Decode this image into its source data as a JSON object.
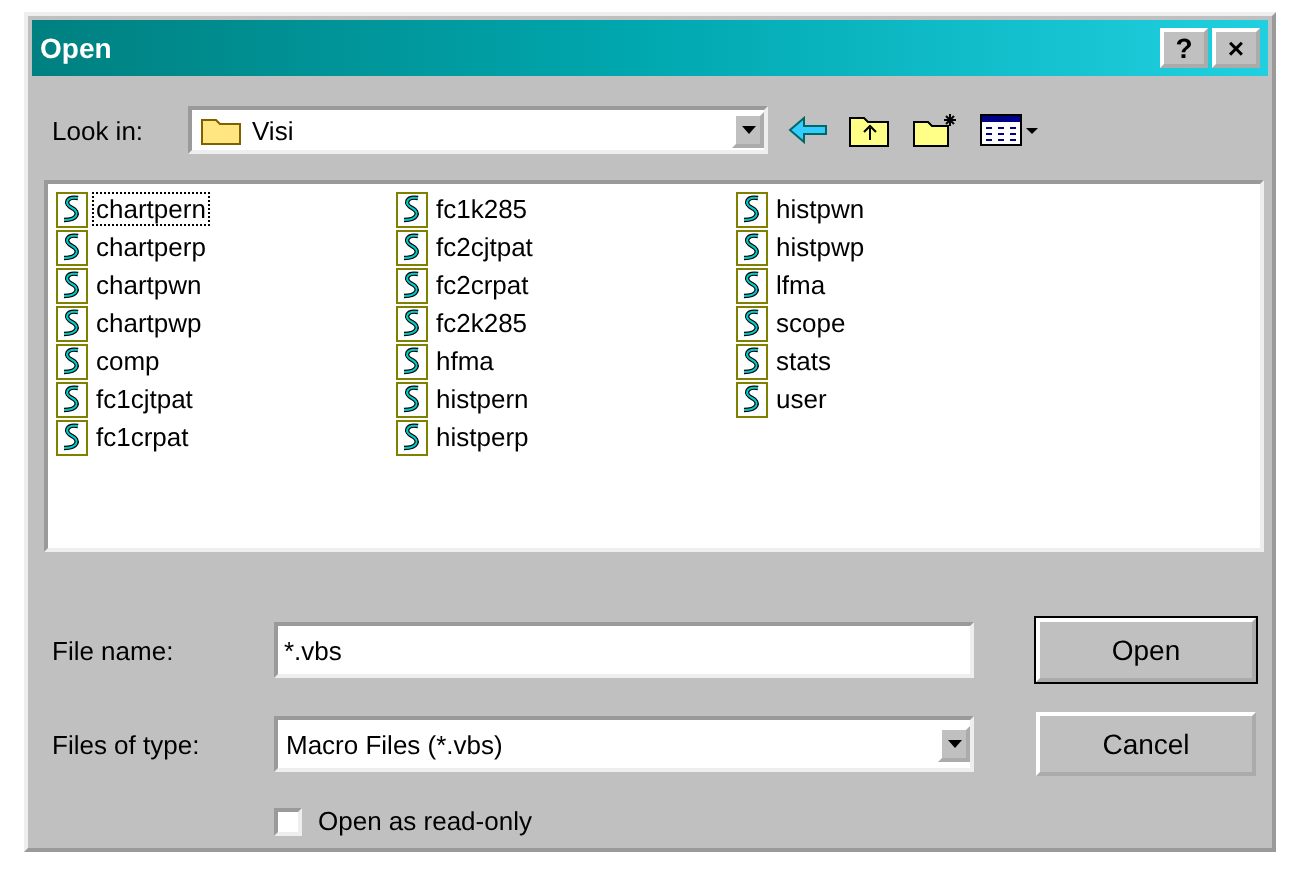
{
  "window": {
    "title": "Open"
  },
  "title_buttons": [
    "?",
    "×"
  ],
  "look_in": {
    "label": "Look in:",
    "value": "Visi"
  },
  "files": [
    {
      "name": "chartpern",
      "selected": true
    },
    {
      "name": "chartperp",
      "selected": false
    },
    {
      "name": "chartpwn",
      "selected": false
    },
    {
      "name": "chartpwp",
      "selected": false
    },
    {
      "name": "comp",
      "selected": false
    },
    {
      "name": "fc1cjtpat",
      "selected": false
    },
    {
      "name": "fc1crpat",
      "selected": false
    },
    {
      "name": "fc1k285",
      "selected": false
    },
    {
      "name": "fc2cjtpat",
      "selected": false
    },
    {
      "name": "fc2crpat",
      "selected": false
    },
    {
      "name": "fc2k285",
      "selected": false
    },
    {
      "name": "hfma",
      "selected": false
    },
    {
      "name": "histpern",
      "selected": false
    },
    {
      "name": "histperp",
      "selected": false
    },
    {
      "name": "histpwn",
      "selected": false
    },
    {
      "name": "histpwp",
      "selected": false
    },
    {
      "name": "lfma",
      "selected": false
    },
    {
      "name": "scope",
      "selected": false
    },
    {
      "name": "stats",
      "selected": false
    },
    {
      "name": "user",
      "selected": false
    }
  ],
  "file_name": {
    "label": "File name:",
    "value": "*.vbs"
  },
  "files_of_type": {
    "label": "Files of type:",
    "value": "Macro Files (*.vbs)"
  },
  "read_only": {
    "label": "Open as read-only",
    "checked": false
  },
  "buttons": [
    {
      "label": "Open",
      "default": true
    },
    {
      "label": "Cancel",
      "default": false
    }
  ]
}
